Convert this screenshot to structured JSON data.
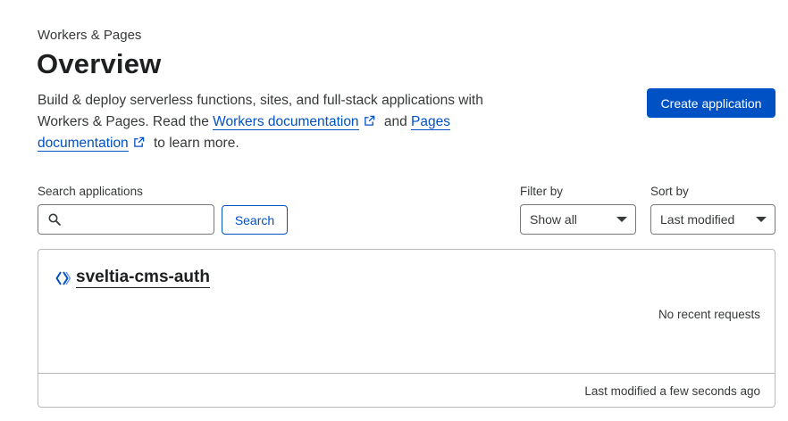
{
  "header": {
    "breadcrumb": "Workers & Pages",
    "title": "Overview"
  },
  "description": {
    "text_before": "Build & deploy serverless functions, sites, and full-stack applications with Workers & Pages. Read the ",
    "link_workers": "Workers documentation",
    "text_middle": " and ",
    "link_pages_1": "Pages",
    "link_pages_2": "documentation",
    "text_after": " to learn more."
  },
  "actions": {
    "create_label": "Create application"
  },
  "search": {
    "label": "Search applications",
    "value": "",
    "placeholder": "",
    "button_label": "Search"
  },
  "filter": {
    "label": "Filter by",
    "selected": "Show all"
  },
  "sort": {
    "label": "Sort by",
    "selected": "Last modified"
  },
  "applications": [
    {
      "name": "sveltia-cms-auth",
      "requests_status": "No recent requests",
      "last_modified": "Last modified a few seconds ago"
    }
  ],
  "colors": {
    "accent": "#0051c3",
    "text": "#36393a",
    "border": "#797979"
  },
  "icons": {
    "external_link": "external-link-icon",
    "search": "search-icon",
    "worker": "workers-icon",
    "dropdown": "chevron-down-icon"
  }
}
